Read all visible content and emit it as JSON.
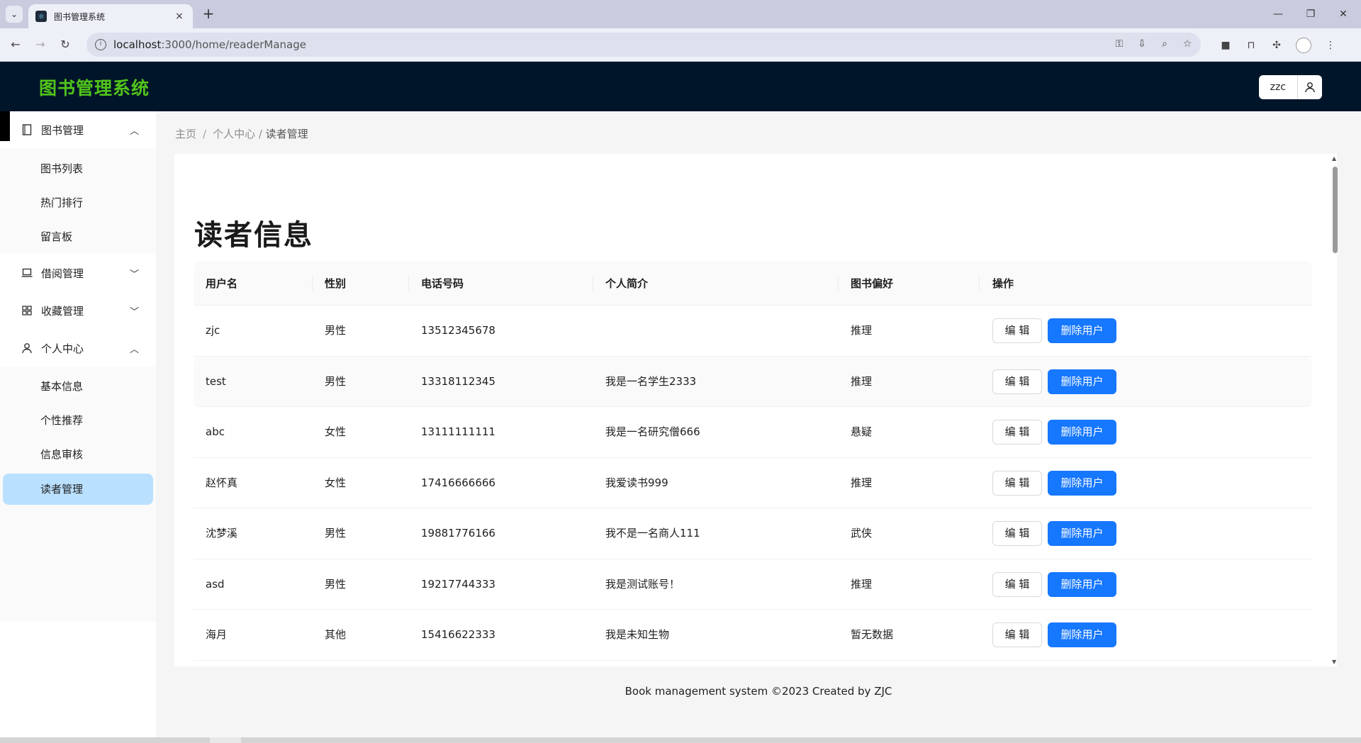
{
  "browser": {
    "tab_title": "图书管理系统",
    "tab_close": "×",
    "new_tab": "+",
    "url_host": "localhost",
    "url_rest": ":3000/home/readerManage",
    "window_controls": {
      "minimize": "—",
      "restore": "❐",
      "close": "✕"
    }
  },
  "header": {
    "app_title": "图书管理系统",
    "username": "zzc"
  },
  "sidebar": {
    "groups": [
      {
        "label": "图书管理",
        "icon": "book-icon",
        "expanded": true,
        "items": [
          "图书列表",
          "热门排行",
          "留言板"
        ]
      },
      {
        "label": "借阅管理",
        "icon": "laptop-icon",
        "expanded": false,
        "items": []
      },
      {
        "label": "收藏管理",
        "icon": "appstore-icon",
        "expanded": false,
        "items": []
      },
      {
        "label": "个人中心",
        "icon": "user-icon",
        "expanded": true,
        "items": [
          "基本信息",
          "个性推荐",
          "信息审核",
          "读者管理"
        ]
      }
    ],
    "active_item": "读者管理"
  },
  "breadcrumb": {
    "home": "主页",
    "sep1": "/",
    "middle": "个人中心 / ",
    "current": "读者管理"
  },
  "page": {
    "title": "读者信息"
  },
  "table": {
    "columns": [
      "用户名",
      "性别",
      "电话号码",
      "个人简介",
      "图书偏好",
      "操作"
    ],
    "edit_label": "编 辑",
    "delete_label": "删除用户",
    "rows": [
      {
        "username": "zjc",
        "gender": "男性",
        "phone": "13512345678",
        "bio": "",
        "preference": "推理"
      },
      {
        "username": "test",
        "gender": "男性",
        "phone": "13318112345",
        "bio": "我是一名学生2333",
        "preference": "推理"
      },
      {
        "username": "abc",
        "gender": "女性",
        "phone": "13111111111",
        "bio": "我是一名研究僧666",
        "preference": "悬疑"
      },
      {
        "username": "赵怀真",
        "gender": "女性",
        "phone": "17416666666",
        "bio": "我爱读书999",
        "preference": "推理"
      },
      {
        "username": "沈梦溪",
        "gender": "男性",
        "phone": "19881776166",
        "bio": "我不是一名商人111",
        "preference": "武侠"
      },
      {
        "username": "asd",
        "gender": "男性",
        "phone": "19217744333",
        "bio": "我是测试账号！",
        "preference": "推理"
      },
      {
        "username": "海月",
        "gender": "其他",
        "phone": "15416622333",
        "bio": "我是未知生物",
        "preference": "暂无数据"
      }
    ]
  },
  "footer": {
    "text": "Book management system ©2023 Created by ZJC"
  },
  "colors": {
    "header_bg": "#001529",
    "title_green": "#52c41a",
    "primary_blue": "#1677ff",
    "active_menu_bg": "#bae0ff"
  }
}
